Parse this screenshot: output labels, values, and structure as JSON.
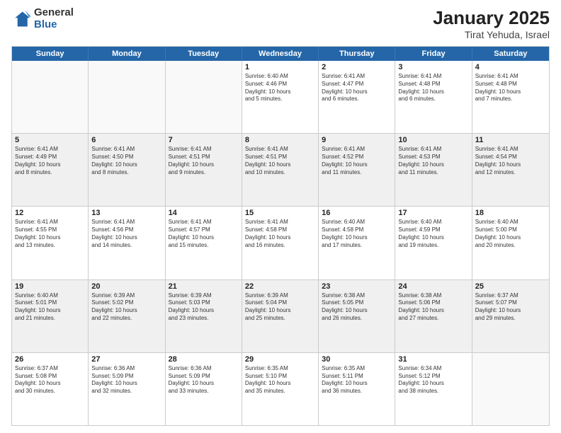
{
  "header": {
    "logo_general": "General",
    "logo_blue": "Blue",
    "title": "January 2025",
    "subtitle": "Tirat Yehuda, Israel"
  },
  "weekdays": [
    "Sunday",
    "Monday",
    "Tuesday",
    "Wednesday",
    "Thursday",
    "Friday",
    "Saturday"
  ],
  "weeks": [
    [
      {
        "day": "",
        "text": "",
        "empty": true
      },
      {
        "day": "",
        "text": "",
        "empty": true
      },
      {
        "day": "",
        "text": "",
        "empty": true
      },
      {
        "day": "1",
        "text": "Sunrise: 6:40 AM\nSunset: 4:46 PM\nDaylight: 10 hours\nand 5 minutes."
      },
      {
        "day": "2",
        "text": "Sunrise: 6:41 AM\nSunset: 4:47 PM\nDaylight: 10 hours\nand 6 minutes."
      },
      {
        "day": "3",
        "text": "Sunrise: 6:41 AM\nSunset: 4:48 PM\nDaylight: 10 hours\nand 6 minutes."
      },
      {
        "day": "4",
        "text": "Sunrise: 6:41 AM\nSunset: 4:48 PM\nDaylight: 10 hours\nand 7 minutes."
      }
    ],
    [
      {
        "day": "5",
        "text": "Sunrise: 6:41 AM\nSunset: 4:49 PM\nDaylight: 10 hours\nand 8 minutes."
      },
      {
        "day": "6",
        "text": "Sunrise: 6:41 AM\nSunset: 4:50 PM\nDaylight: 10 hours\nand 8 minutes."
      },
      {
        "day": "7",
        "text": "Sunrise: 6:41 AM\nSunset: 4:51 PM\nDaylight: 10 hours\nand 9 minutes."
      },
      {
        "day": "8",
        "text": "Sunrise: 6:41 AM\nSunset: 4:51 PM\nDaylight: 10 hours\nand 10 minutes."
      },
      {
        "day": "9",
        "text": "Sunrise: 6:41 AM\nSunset: 4:52 PM\nDaylight: 10 hours\nand 11 minutes."
      },
      {
        "day": "10",
        "text": "Sunrise: 6:41 AM\nSunset: 4:53 PM\nDaylight: 10 hours\nand 11 minutes."
      },
      {
        "day": "11",
        "text": "Sunrise: 6:41 AM\nSunset: 4:54 PM\nDaylight: 10 hours\nand 12 minutes."
      }
    ],
    [
      {
        "day": "12",
        "text": "Sunrise: 6:41 AM\nSunset: 4:55 PM\nDaylight: 10 hours\nand 13 minutes."
      },
      {
        "day": "13",
        "text": "Sunrise: 6:41 AM\nSunset: 4:56 PM\nDaylight: 10 hours\nand 14 minutes."
      },
      {
        "day": "14",
        "text": "Sunrise: 6:41 AM\nSunset: 4:57 PM\nDaylight: 10 hours\nand 15 minutes."
      },
      {
        "day": "15",
        "text": "Sunrise: 6:41 AM\nSunset: 4:58 PM\nDaylight: 10 hours\nand 16 minutes."
      },
      {
        "day": "16",
        "text": "Sunrise: 6:40 AM\nSunset: 4:58 PM\nDaylight: 10 hours\nand 17 minutes."
      },
      {
        "day": "17",
        "text": "Sunrise: 6:40 AM\nSunset: 4:59 PM\nDaylight: 10 hours\nand 19 minutes."
      },
      {
        "day": "18",
        "text": "Sunrise: 6:40 AM\nSunset: 5:00 PM\nDaylight: 10 hours\nand 20 minutes."
      }
    ],
    [
      {
        "day": "19",
        "text": "Sunrise: 6:40 AM\nSunset: 5:01 PM\nDaylight: 10 hours\nand 21 minutes."
      },
      {
        "day": "20",
        "text": "Sunrise: 6:39 AM\nSunset: 5:02 PM\nDaylight: 10 hours\nand 22 minutes."
      },
      {
        "day": "21",
        "text": "Sunrise: 6:39 AM\nSunset: 5:03 PM\nDaylight: 10 hours\nand 23 minutes."
      },
      {
        "day": "22",
        "text": "Sunrise: 6:39 AM\nSunset: 5:04 PM\nDaylight: 10 hours\nand 25 minutes."
      },
      {
        "day": "23",
        "text": "Sunrise: 6:38 AM\nSunset: 5:05 PM\nDaylight: 10 hours\nand 26 minutes."
      },
      {
        "day": "24",
        "text": "Sunrise: 6:38 AM\nSunset: 5:06 PM\nDaylight: 10 hours\nand 27 minutes."
      },
      {
        "day": "25",
        "text": "Sunrise: 6:37 AM\nSunset: 5:07 PM\nDaylight: 10 hours\nand 29 minutes."
      }
    ],
    [
      {
        "day": "26",
        "text": "Sunrise: 6:37 AM\nSunset: 5:08 PM\nDaylight: 10 hours\nand 30 minutes."
      },
      {
        "day": "27",
        "text": "Sunrise: 6:36 AM\nSunset: 5:09 PM\nDaylight: 10 hours\nand 32 minutes."
      },
      {
        "day": "28",
        "text": "Sunrise: 6:36 AM\nSunset: 5:09 PM\nDaylight: 10 hours\nand 33 minutes."
      },
      {
        "day": "29",
        "text": "Sunrise: 6:35 AM\nSunset: 5:10 PM\nDaylight: 10 hours\nand 35 minutes."
      },
      {
        "day": "30",
        "text": "Sunrise: 6:35 AM\nSunset: 5:11 PM\nDaylight: 10 hours\nand 36 minutes."
      },
      {
        "day": "31",
        "text": "Sunrise: 6:34 AM\nSunset: 5:12 PM\nDaylight: 10 hours\nand 38 minutes."
      },
      {
        "day": "",
        "text": "",
        "empty": true
      }
    ]
  ]
}
